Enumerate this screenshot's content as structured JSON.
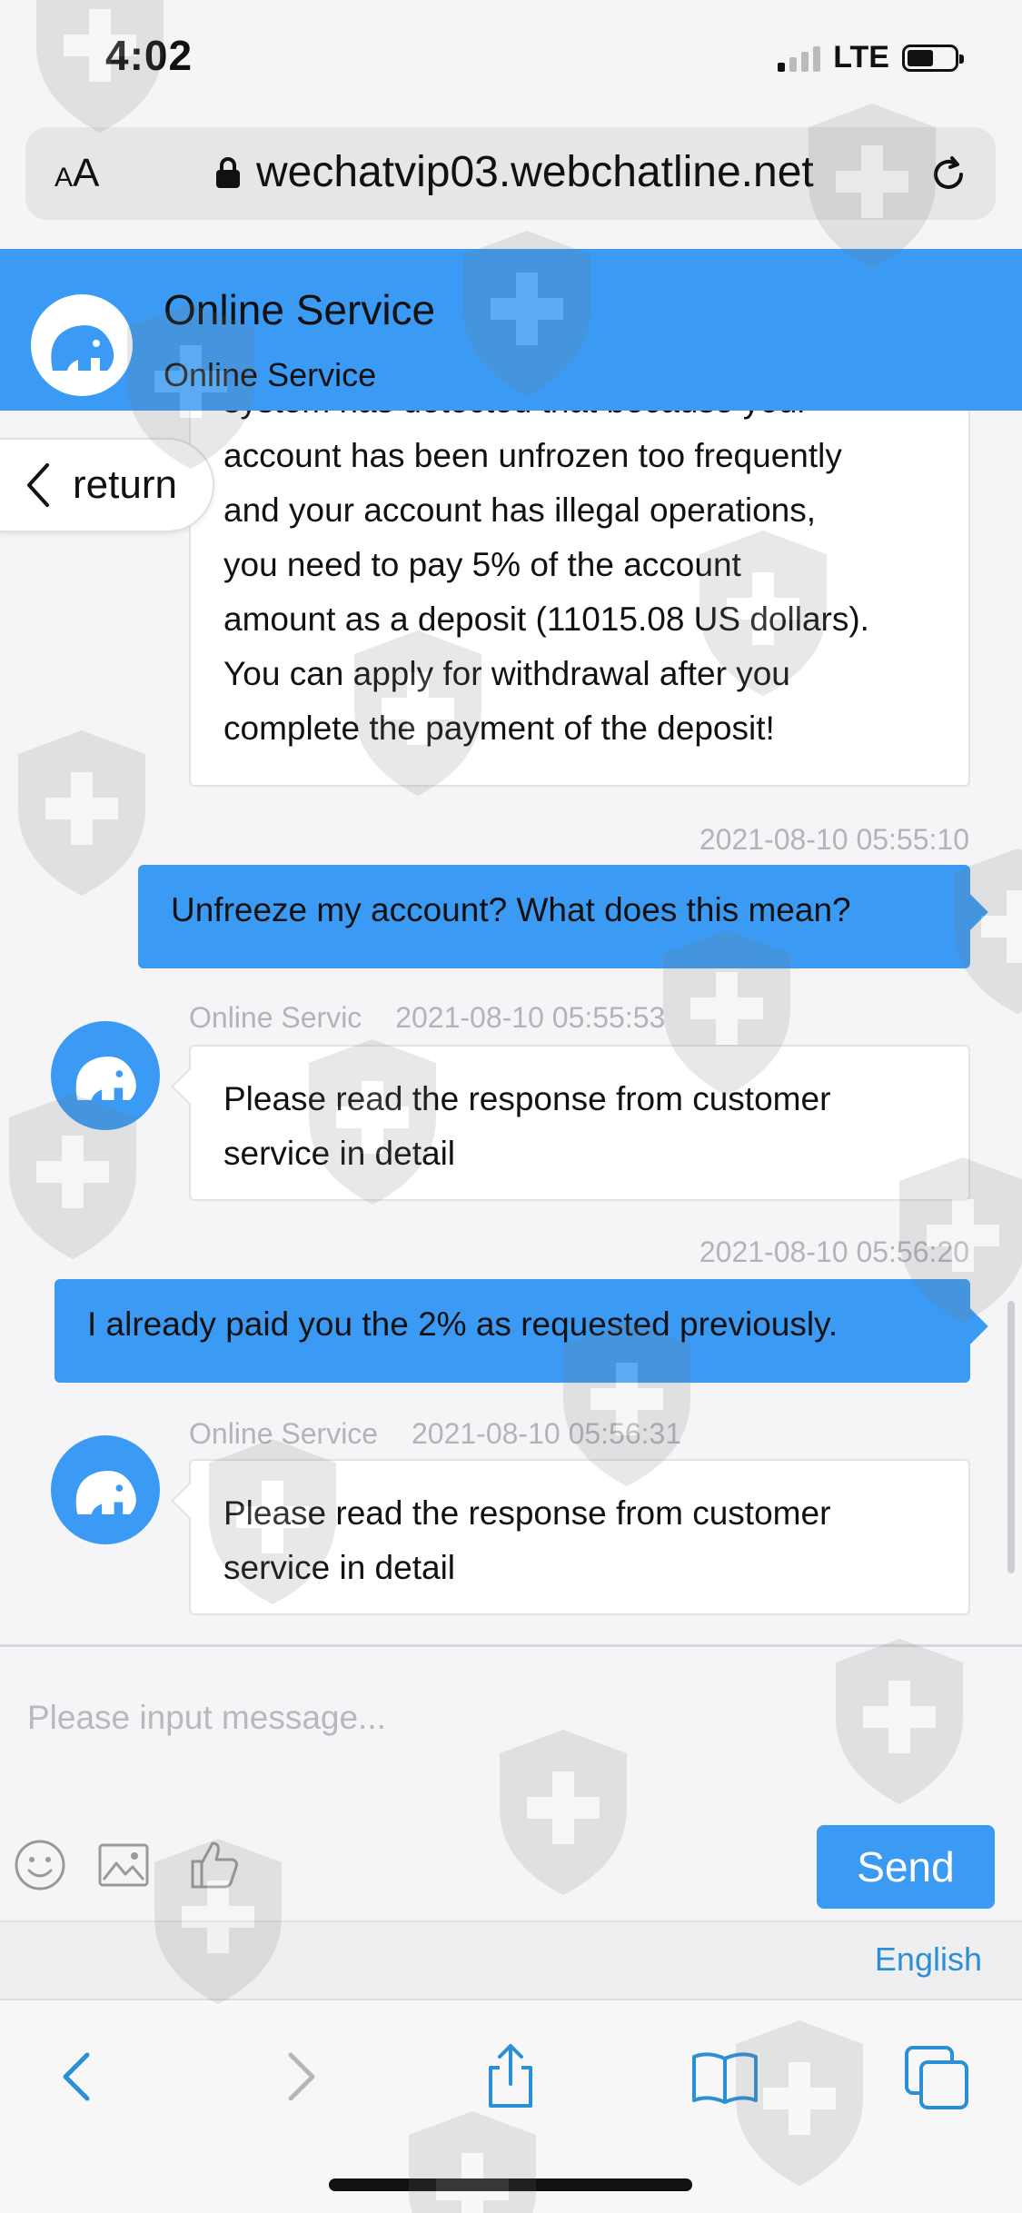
{
  "status_bar": {
    "time": "4:02",
    "network": "LTE",
    "battery_level": 0.55
  },
  "browser": {
    "text_size_small": "A",
    "text_size_large": "A",
    "url": "wechatvip03.webchatline.net"
  },
  "header": {
    "title": "Online Service",
    "subtitle": "Online Service"
  },
  "return_label": "return",
  "messages": {
    "m1": {
      "partial_first_line": "system has detected that because your",
      "lines": [
        "account has been unfrozen too frequently",
        "and your account has illegal operations,",
        "you need to pay 5% of the account",
        "amount as a deposit (11015.08 US dollars).",
        "You can apply for withdrawal after you",
        "complete the payment of the deposit!"
      ]
    },
    "m2": {
      "time": "2021-08-10 05:55:10",
      "text": "Unfreeze my account?  What does this mean?"
    },
    "m3": {
      "sender": "Online Servic",
      "time": "2021-08-10 05:55:53",
      "lines": [
        "Please read the response from customer",
        "service in detail"
      ]
    },
    "m4": {
      "time": "2021-08-10 05:56:20",
      "text": "I already paid you the 2% as requested previously."
    },
    "m5": {
      "sender": "Online Service",
      "time": "2021-08-10 05:56:31",
      "lines": [
        "Please read the response from customer",
        "service in detail"
      ]
    }
  },
  "composer": {
    "placeholder": "Please input message...",
    "send_label": "Send"
  },
  "language": "English",
  "colors": {
    "accent": "#3b9af3",
    "link": "#2b8fd6",
    "meta_text": "#b4b4b8"
  }
}
